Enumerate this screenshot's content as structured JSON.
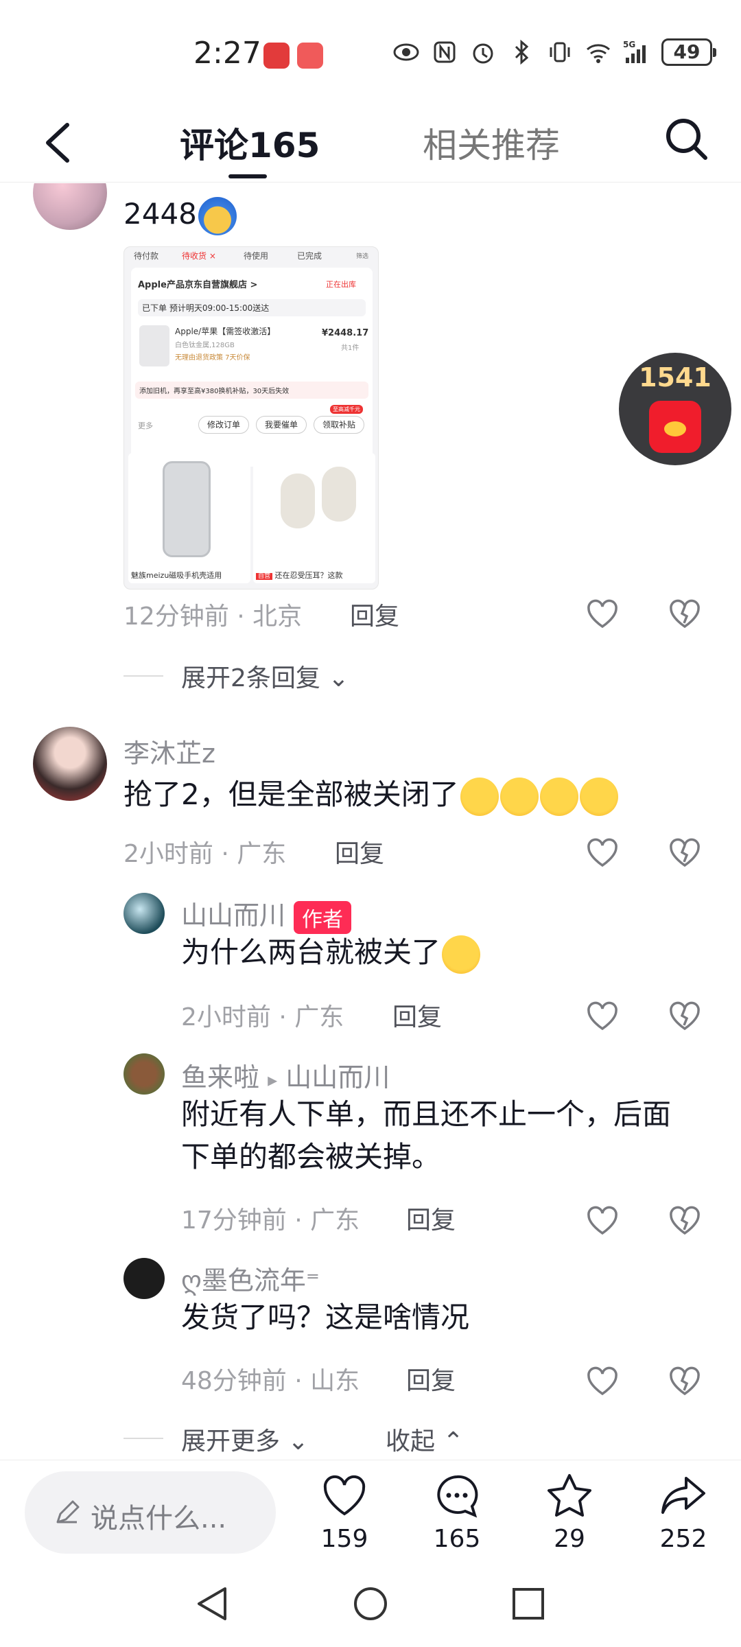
{
  "status_bar": {
    "time": "2:27",
    "battery": "49",
    "network": "5G"
  },
  "header": {
    "tab_comments": "评论165",
    "tab_related": "相关推荐"
  },
  "comment1": {
    "text": "2448",
    "meta": "12分钟前 · 北京",
    "reply": "回复",
    "expand": "展开2条回复",
    "image": {
      "tabs": [
        "待付款",
        "待收货 ×",
        "待使用",
        "已完成"
      ],
      "filter": "筛选",
      "store": "Apple产品京东自营旗舰店 >",
      "store_status": "正在出库",
      "shipping": "已下单  预计明天09:00-15:00送达",
      "product_name": "Apple/苹果【需签收激活】",
      "product_spec": "白色钛金属,128GB",
      "product_tags": "无理由退货政策  7天价保",
      "price": "¥2448.17",
      "quantity": "共1件",
      "tradein": "添加旧机，再享至高¥380换机补贴，30天后失效",
      "more": "更多",
      "btn_modify": "修改订单",
      "btn_urge": "我要催单",
      "btn_subsidy": "领取补贴",
      "badge_subsidy": "至高减千元",
      "rec1": "魅族meizu磁吸手机壳适用",
      "rec2": "还在忍受压耳？这款",
      "rec2_badge": "自营"
    }
  },
  "comment2": {
    "username": "李沐芷z",
    "text": "抢了2，但是全部被关闭了",
    "meta": "2小时前 · 广东",
    "reply": "回复"
  },
  "reply1": {
    "username": "山山而川",
    "author_tag": "作者",
    "text": "为什么两台就被关了",
    "meta": "2小时前 · 广东",
    "reply": "回复"
  },
  "reply2": {
    "username": "鱼来啦",
    "reply_to": "山山而川",
    "text_line1": "附近有人下单，而且还不止一个，后面",
    "text_line2": "下单的都会被关掉。",
    "meta": "17分钟前 · 广东",
    "reply": "回复"
  },
  "reply3": {
    "username": "ღ墨色流年⁼",
    "text": "发货了吗？这是啥情况",
    "meta": "48分钟前 · 山东",
    "reply": "回复"
  },
  "expand_more": "展开更多",
  "collapse": "收起",
  "red_envelope": {
    "count": "1541"
  },
  "bottom_bar": {
    "placeholder": "说点什么...",
    "likes": "159",
    "comments": "165",
    "favorites": "29",
    "shares": "252"
  },
  "colors": {
    "accent": "#fe2c55",
    "text": "#161823",
    "meta": "#a0a1a6"
  }
}
